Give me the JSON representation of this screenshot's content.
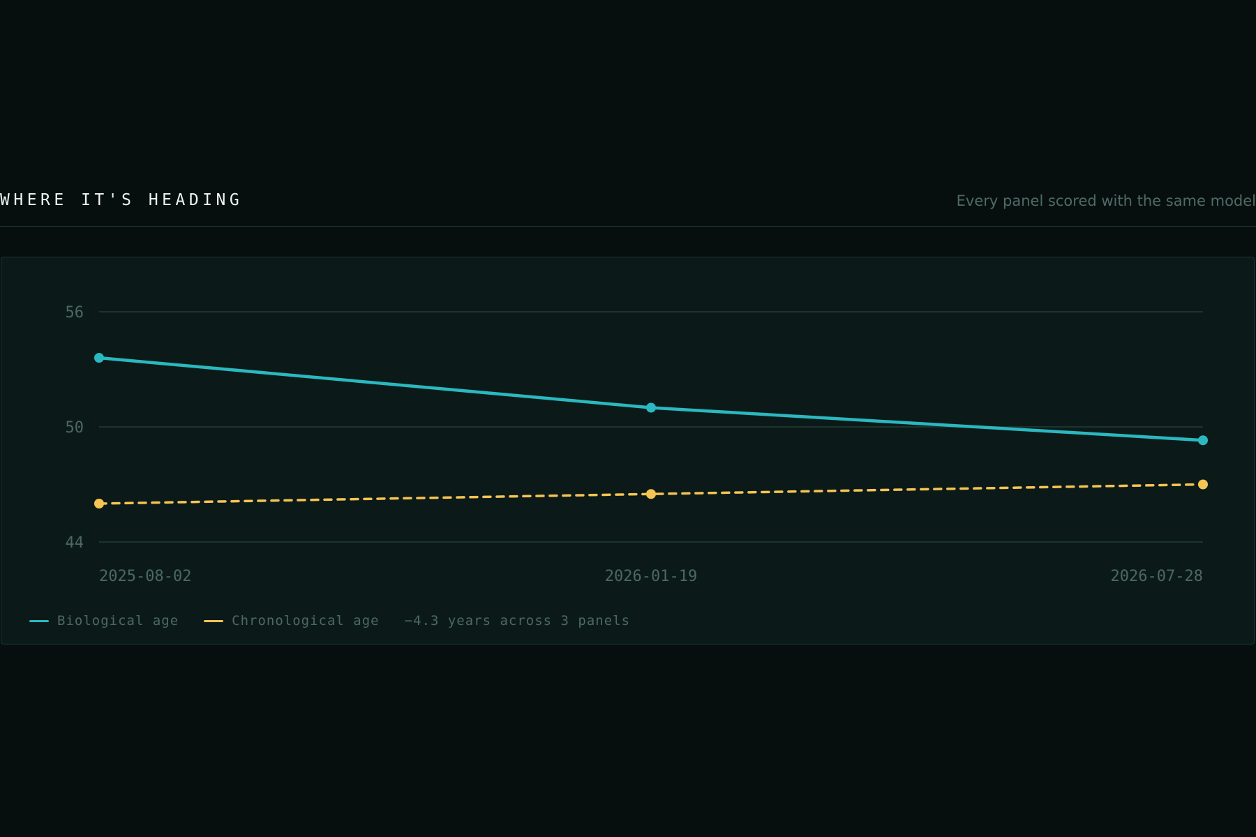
{
  "section": {
    "title": "WHERE IT'S HEADING",
    "note": "Every panel scored with the same model"
  },
  "colors": {
    "biological": "#2bb8c0",
    "chronological": "#f6c453",
    "grid": "#1d332f",
    "tick": "#4c6863"
  },
  "legend": {
    "biological_label": "Biological age",
    "chronological_label": "Chronological age",
    "summary": "−4.3 years across 3 panels"
  },
  "chart_data": {
    "type": "line",
    "x": [
      "2025-08-02",
      "2026-01-19",
      "2026-07-28"
    ],
    "x_tick_labels": [
      "2025-08-02",
      "2026-01-19",
      "2026-07-28"
    ],
    "ylim": [
      44,
      56
    ],
    "yticks": [
      56,
      50,
      44
    ],
    "grid": true,
    "legend_position": "bottom-left",
    "series": [
      {
        "name": "Biological age",
        "values": [
          53.6,
          51.0,
          49.3
        ],
        "style": "solid",
        "color": "#2bb8c0"
      },
      {
        "name": "Chronological age",
        "values": [
          46.0,
          46.5,
          47.0
        ],
        "style": "dashed",
        "color": "#f6c453"
      }
    ]
  }
}
